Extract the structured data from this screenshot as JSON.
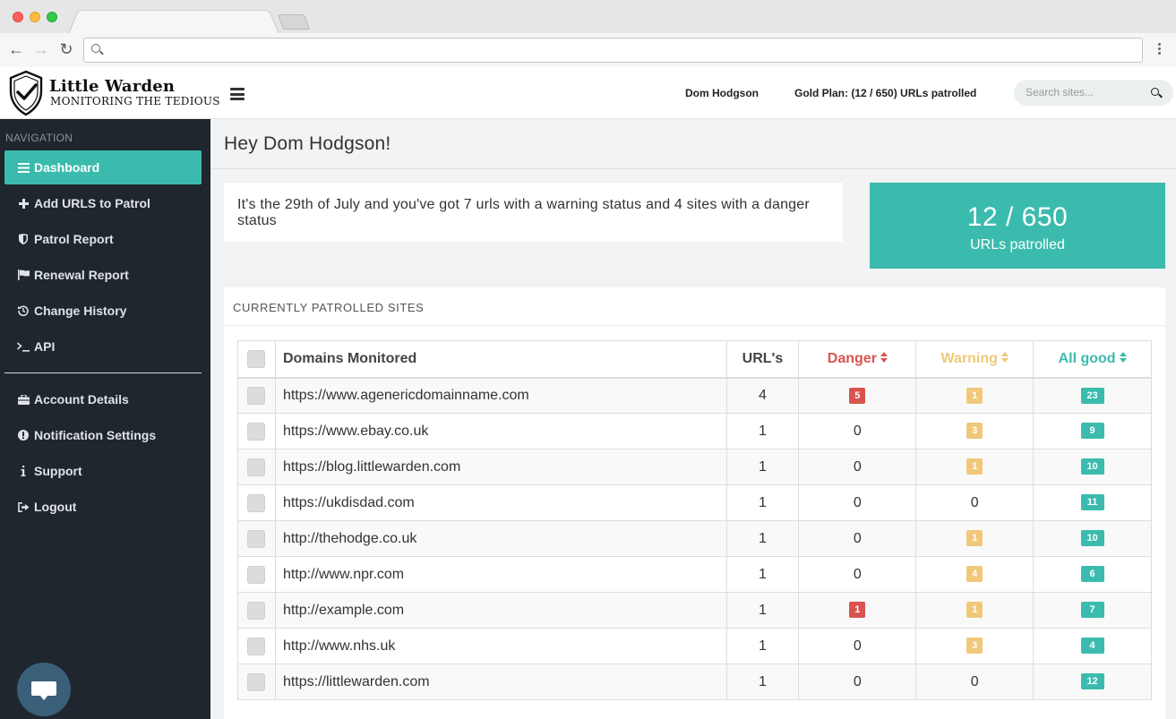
{
  "browser": {
    "address": ""
  },
  "header": {
    "brand_title": "Little Warden",
    "brand_tagline": "MONITORING THE TEDIOUS",
    "user_name": "Dom Hodgson",
    "plan": "Gold Plan: (12 / 650) URLs patrolled",
    "search_placeholder": "Search sites..."
  },
  "sidebar": {
    "heading": "NAVIGATION",
    "items": [
      {
        "label": "Dashboard",
        "icon": "bars-icon",
        "active": true
      },
      {
        "label": "Add URLS to Patrol",
        "icon": "plus-icon"
      },
      {
        "label": "Patrol Report",
        "icon": "shield-icon"
      },
      {
        "label": "Renewal Report",
        "icon": "flag-icon"
      },
      {
        "label": "Change History",
        "icon": "history-icon"
      },
      {
        "label": "API",
        "icon": "terminal-icon"
      },
      {
        "label": "Account Details",
        "icon": "briefcase-icon"
      },
      {
        "label": "Notification Settings",
        "icon": "exclamation-icon"
      },
      {
        "label": "Support",
        "icon": "info-icon"
      },
      {
        "label": "Logout",
        "icon": "sign-out-icon"
      }
    ]
  },
  "main": {
    "greeting": "Hey Dom Hodgson!",
    "message": "It's the 29th of July and you've got 7 urls with a warning status and 4 sites with a danger status",
    "stat_value": "12 / 650",
    "stat_label": "URLs patrolled",
    "panel_title": "CURRENTLY PATROLLED SITES",
    "table": {
      "columns": [
        "Domains Monitored",
        "URL's",
        "Danger",
        "Warning",
        "All good"
      ],
      "rows": [
        {
          "domain": "https://www.agenericdomainname.com",
          "urls": "4",
          "danger": "5",
          "warning": "1",
          "good": "23"
        },
        {
          "domain": "https://www.ebay.co.uk",
          "urls": "1",
          "danger": "0",
          "warning": "3",
          "good": "9"
        },
        {
          "domain": "https://blog.littlewarden.com",
          "urls": "1",
          "danger": "0",
          "warning": "1",
          "good": "10"
        },
        {
          "domain": "https://ukdisdad.com",
          "urls": "1",
          "danger": "0",
          "warning": "0",
          "good": "11"
        },
        {
          "domain": "http://thehodge.co.uk",
          "urls": "1",
          "danger": "0",
          "warning": "1",
          "good": "10"
        },
        {
          "domain": "http://www.npr.com",
          "urls": "1",
          "danger": "0",
          "warning": "4",
          "good": "6"
        },
        {
          "domain": "http://example.com",
          "urls": "1",
          "danger": "1",
          "warning": "1",
          "good": "7"
        },
        {
          "domain": "http://www.nhs.uk",
          "urls": "1",
          "danger": "0",
          "warning": "3",
          "good": "4"
        },
        {
          "domain": "https://littlewarden.com",
          "urls": "1",
          "danger": "0",
          "warning": "0",
          "good": "12"
        }
      ]
    }
  },
  "colors": {
    "accent": "#3bbbad",
    "danger": "#d9534f",
    "warning": "#f0c87a",
    "sidebar_bg": "#1f262e"
  }
}
